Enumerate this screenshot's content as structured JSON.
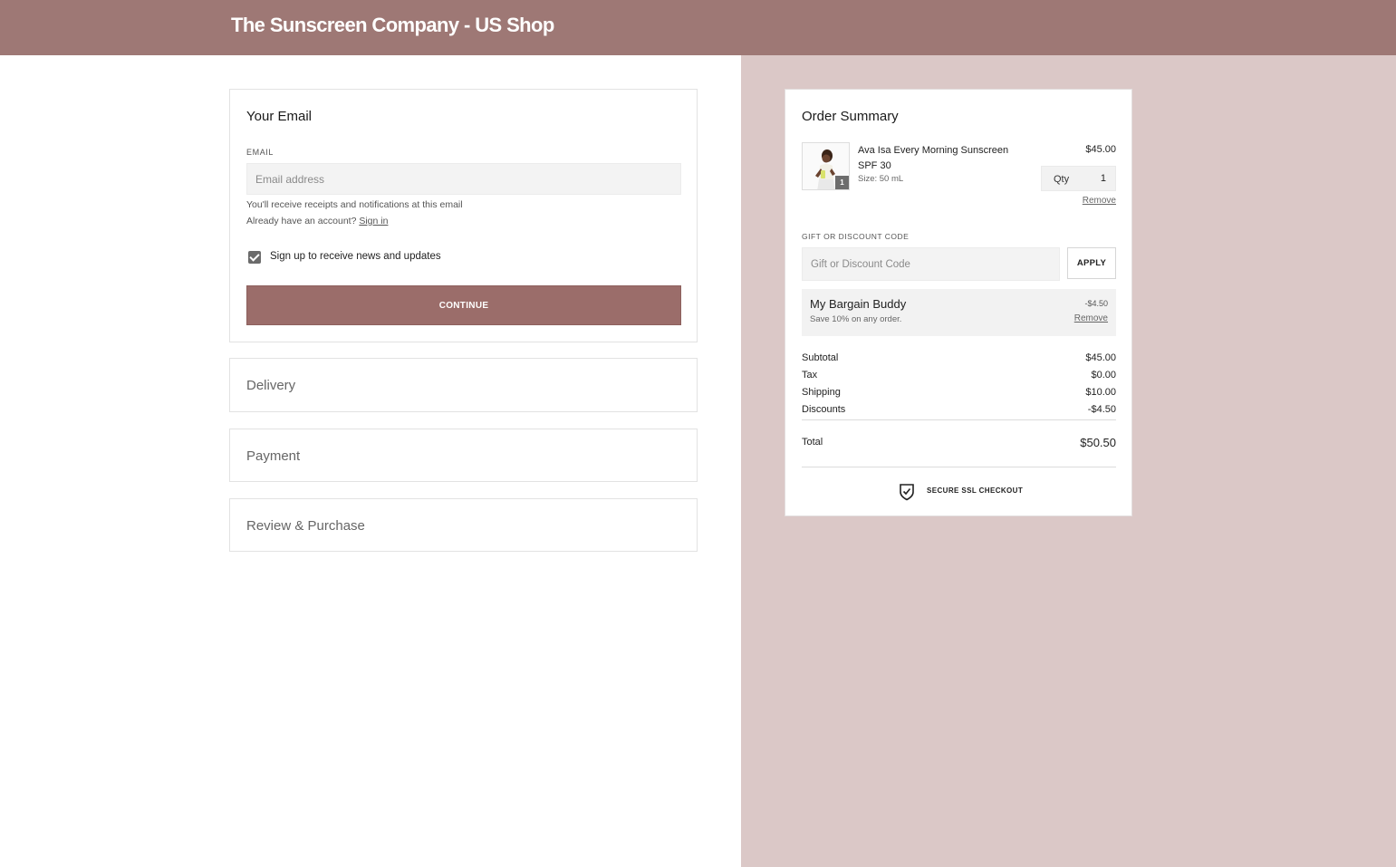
{
  "header": {
    "title": "The Sunscreen Company - US Shop"
  },
  "email_section": {
    "title": "Your Email",
    "field_label": "EMAIL",
    "email_value": "",
    "email_placeholder": "Email address",
    "helper_text": "You'll receive receipts and notifications at this email",
    "account_prompt": "Already have an account?",
    "sign_in_label": "Sign in",
    "newsletter_label": "Sign up to receive news and updates",
    "newsletter_checked": true,
    "continue_label": "CONTINUE"
  },
  "steps": {
    "delivery": "Delivery",
    "payment": "Payment",
    "review": "Review & Purchase"
  },
  "order_summary": {
    "title": "Order Summary",
    "item": {
      "name": "Ava Isa Every Morning Sunscreen SPF 30",
      "size": "Size: 50 mL",
      "price": "$45.00",
      "qty_label": "Qty",
      "qty": "1",
      "badge_count": "1",
      "remove_label": "Remove"
    },
    "gift": {
      "label": "GIFT OR DISCOUNT CODE",
      "value": "",
      "placeholder": "Gift or Discount Code",
      "apply_label": "APPLY"
    },
    "promo": {
      "name": "My Bargain Buddy",
      "description": "Save 10% on any order.",
      "amount": "-$4.50",
      "remove_label": "Remove"
    },
    "totals": {
      "subtotal_label": "Subtotal",
      "subtotal": "$45.00",
      "tax_label": "Tax",
      "tax": "$0.00",
      "shipping_label": "Shipping",
      "shipping": "$10.00",
      "discounts_label": "Discounts",
      "discounts": "-$4.50",
      "total_label": "Total",
      "total": "$50.50"
    },
    "secure_label": "SECURE SSL CHECKOUT"
  },
  "colors": {
    "header_bg": "#9e7875",
    "accent_button": "#9b6d6a",
    "summary_bg": "#dbc8c7"
  },
  "icons": [
    "checkbox-check-icon",
    "shield-check-icon",
    "product-thumbnail"
  ]
}
